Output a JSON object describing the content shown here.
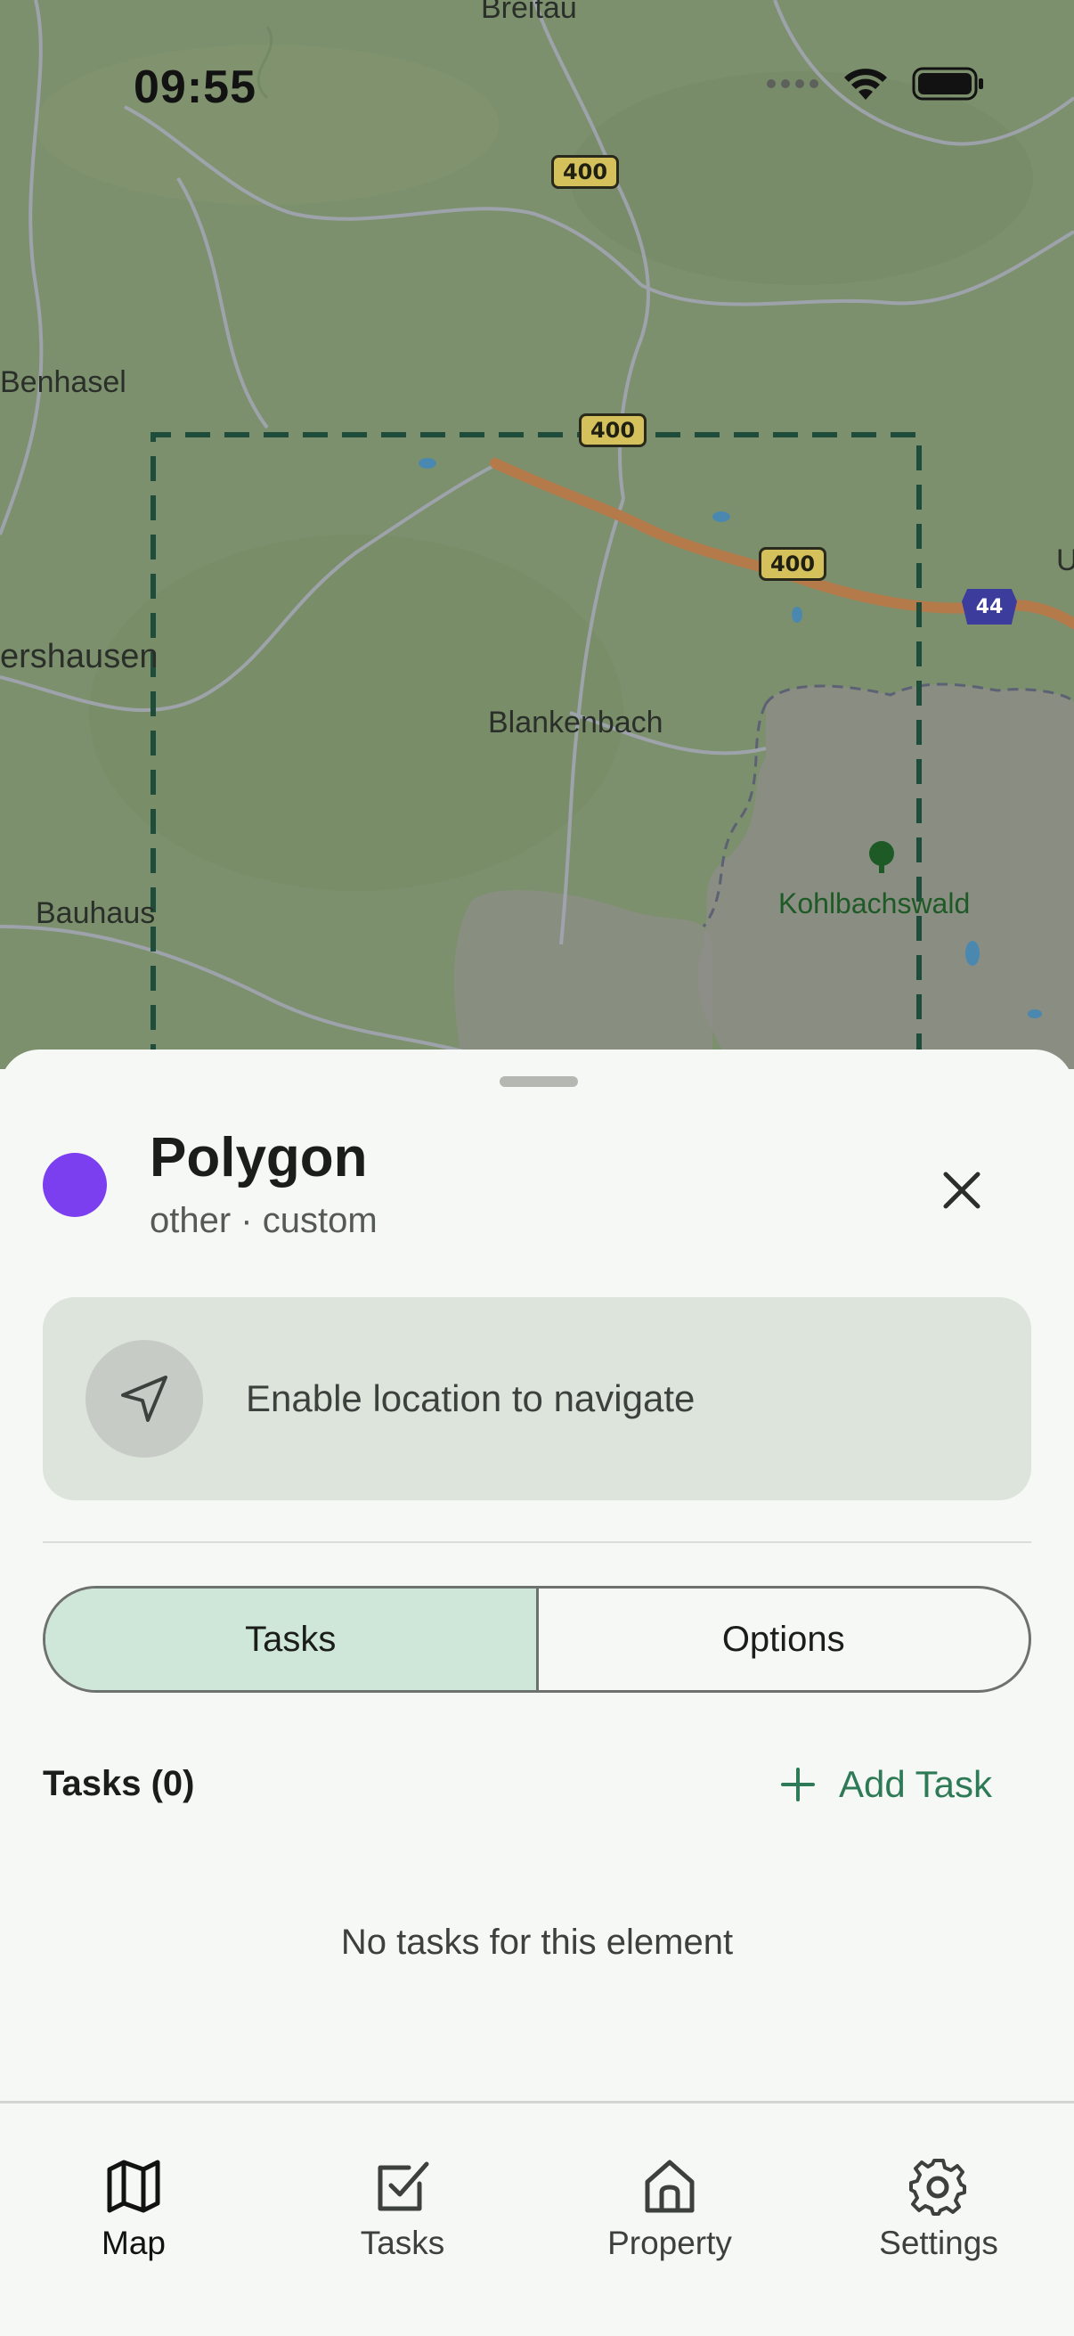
{
  "status_bar": {
    "time": "09:55",
    "icons": [
      "signal-icon",
      "wifi-icon",
      "battery-icon"
    ]
  },
  "map": {
    "place_labels": [
      "Breitau",
      "Benhasel",
      "ershausen",
      "Blankenbach",
      "Bauhaus",
      "Kohlbachswald",
      "U"
    ],
    "road_shields": [
      "400",
      "400",
      "400"
    ],
    "highway_shield": "44",
    "colors": {
      "selection_outline": "#1f4d3c",
      "road": "#b57a4a"
    }
  },
  "sheet": {
    "title": "Polygon",
    "subtitle": "other · custom",
    "color": "#7b3ff0",
    "nav_prompt": "Enable location to navigate",
    "segments": [
      {
        "label": "Tasks",
        "active": true
      },
      {
        "label": "Options",
        "active": false
      }
    ],
    "tasks_heading": "Tasks (0)",
    "add_task_label": "Add Task",
    "empty_message": "No tasks for this element",
    "accent": "#2e7a56"
  },
  "tabbar": {
    "items": [
      {
        "label": "Map",
        "icon": "map-icon",
        "active": true
      },
      {
        "label": "Tasks",
        "icon": "checkbox-icon",
        "active": false
      },
      {
        "label": "Property",
        "icon": "home-icon",
        "active": false
      },
      {
        "label": "Settings",
        "icon": "gear-icon",
        "active": false
      }
    ]
  }
}
